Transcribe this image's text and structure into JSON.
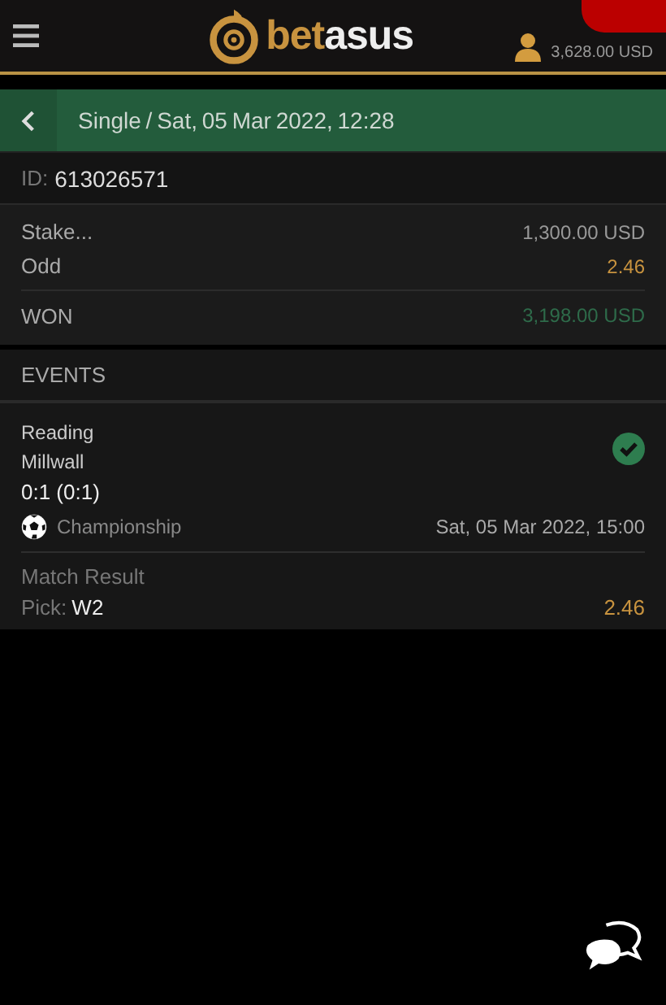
{
  "header": {
    "logo": {
      "part_1": "bet",
      "part_2": "asus"
    },
    "balance": "3,628.00 USD"
  },
  "title_bar": {
    "title": "Single / Sat,  05  Mar  2022,  12:28"
  },
  "bet_id": {
    "label": "ID:",
    "value": "613026571"
  },
  "summary": [
    {
      "label": "Stake...",
      "value": "1,300.00 USD",
      "kind": "amount"
    },
    {
      "label": "Odd",
      "value": "2.46",
      "kind": "odd"
    },
    {
      "label": "WON",
      "value": "3,198.00 USD",
      "kind": "win"
    }
  ],
  "events_heading": "EVENTS",
  "events": [
    {
      "home": "Reading",
      "away": "Millwall",
      "score": "0:1 (0:1)",
      "won": true,
      "league": "Championship",
      "date": "Sat,  05  Mar  2022,  15:00",
      "market": "Match  Result",
      "pick_label": "Pick:",
      "pick": "W2",
      "odd": "2.46"
    }
  ]
}
